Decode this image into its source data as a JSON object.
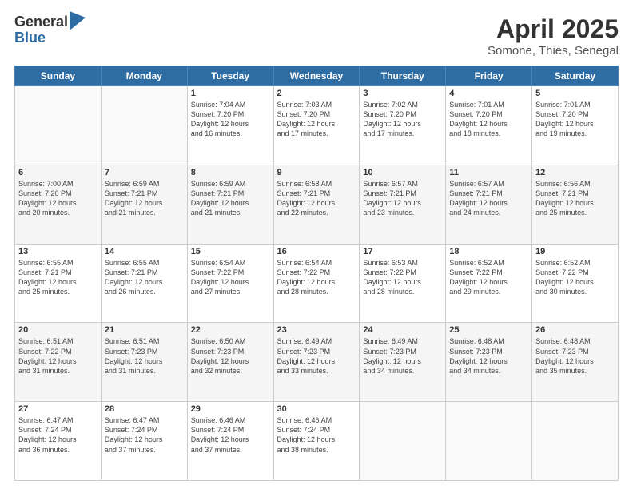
{
  "logo": {
    "general": "General",
    "blue": "Blue"
  },
  "header": {
    "month": "April 2025",
    "location": "Somone, Thies, Senegal"
  },
  "weekdays": [
    "Sunday",
    "Monday",
    "Tuesday",
    "Wednesday",
    "Thursday",
    "Friday",
    "Saturday"
  ],
  "weeks": [
    [
      {
        "day": "",
        "info": ""
      },
      {
        "day": "",
        "info": ""
      },
      {
        "day": "1",
        "info": "Sunrise: 7:04 AM\nSunset: 7:20 PM\nDaylight: 12 hours\nand 16 minutes."
      },
      {
        "day": "2",
        "info": "Sunrise: 7:03 AM\nSunset: 7:20 PM\nDaylight: 12 hours\nand 17 minutes."
      },
      {
        "day": "3",
        "info": "Sunrise: 7:02 AM\nSunset: 7:20 PM\nDaylight: 12 hours\nand 17 minutes."
      },
      {
        "day": "4",
        "info": "Sunrise: 7:01 AM\nSunset: 7:20 PM\nDaylight: 12 hours\nand 18 minutes."
      },
      {
        "day": "5",
        "info": "Sunrise: 7:01 AM\nSunset: 7:20 PM\nDaylight: 12 hours\nand 19 minutes."
      }
    ],
    [
      {
        "day": "6",
        "info": "Sunrise: 7:00 AM\nSunset: 7:20 PM\nDaylight: 12 hours\nand 20 minutes."
      },
      {
        "day": "7",
        "info": "Sunrise: 6:59 AM\nSunset: 7:21 PM\nDaylight: 12 hours\nand 21 minutes."
      },
      {
        "day": "8",
        "info": "Sunrise: 6:59 AM\nSunset: 7:21 PM\nDaylight: 12 hours\nand 21 minutes."
      },
      {
        "day": "9",
        "info": "Sunrise: 6:58 AM\nSunset: 7:21 PM\nDaylight: 12 hours\nand 22 minutes."
      },
      {
        "day": "10",
        "info": "Sunrise: 6:57 AM\nSunset: 7:21 PM\nDaylight: 12 hours\nand 23 minutes."
      },
      {
        "day": "11",
        "info": "Sunrise: 6:57 AM\nSunset: 7:21 PM\nDaylight: 12 hours\nand 24 minutes."
      },
      {
        "day": "12",
        "info": "Sunrise: 6:56 AM\nSunset: 7:21 PM\nDaylight: 12 hours\nand 25 minutes."
      }
    ],
    [
      {
        "day": "13",
        "info": "Sunrise: 6:55 AM\nSunset: 7:21 PM\nDaylight: 12 hours\nand 25 minutes."
      },
      {
        "day": "14",
        "info": "Sunrise: 6:55 AM\nSunset: 7:21 PM\nDaylight: 12 hours\nand 26 minutes."
      },
      {
        "day": "15",
        "info": "Sunrise: 6:54 AM\nSunset: 7:22 PM\nDaylight: 12 hours\nand 27 minutes."
      },
      {
        "day": "16",
        "info": "Sunrise: 6:54 AM\nSunset: 7:22 PM\nDaylight: 12 hours\nand 28 minutes."
      },
      {
        "day": "17",
        "info": "Sunrise: 6:53 AM\nSunset: 7:22 PM\nDaylight: 12 hours\nand 28 minutes."
      },
      {
        "day": "18",
        "info": "Sunrise: 6:52 AM\nSunset: 7:22 PM\nDaylight: 12 hours\nand 29 minutes."
      },
      {
        "day": "19",
        "info": "Sunrise: 6:52 AM\nSunset: 7:22 PM\nDaylight: 12 hours\nand 30 minutes."
      }
    ],
    [
      {
        "day": "20",
        "info": "Sunrise: 6:51 AM\nSunset: 7:22 PM\nDaylight: 12 hours\nand 31 minutes."
      },
      {
        "day": "21",
        "info": "Sunrise: 6:51 AM\nSunset: 7:23 PM\nDaylight: 12 hours\nand 31 minutes."
      },
      {
        "day": "22",
        "info": "Sunrise: 6:50 AM\nSunset: 7:23 PM\nDaylight: 12 hours\nand 32 minutes."
      },
      {
        "day": "23",
        "info": "Sunrise: 6:49 AM\nSunset: 7:23 PM\nDaylight: 12 hours\nand 33 minutes."
      },
      {
        "day": "24",
        "info": "Sunrise: 6:49 AM\nSunset: 7:23 PM\nDaylight: 12 hours\nand 34 minutes."
      },
      {
        "day": "25",
        "info": "Sunrise: 6:48 AM\nSunset: 7:23 PM\nDaylight: 12 hours\nand 34 minutes."
      },
      {
        "day": "26",
        "info": "Sunrise: 6:48 AM\nSunset: 7:23 PM\nDaylight: 12 hours\nand 35 minutes."
      }
    ],
    [
      {
        "day": "27",
        "info": "Sunrise: 6:47 AM\nSunset: 7:24 PM\nDaylight: 12 hours\nand 36 minutes."
      },
      {
        "day": "28",
        "info": "Sunrise: 6:47 AM\nSunset: 7:24 PM\nDaylight: 12 hours\nand 37 minutes."
      },
      {
        "day": "29",
        "info": "Sunrise: 6:46 AM\nSunset: 7:24 PM\nDaylight: 12 hours\nand 37 minutes."
      },
      {
        "day": "30",
        "info": "Sunrise: 6:46 AM\nSunset: 7:24 PM\nDaylight: 12 hours\nand 38 minutes."
      },
      {
        "day": "",
        "info": ""
      },
      {
        "day": "",
        "info": ""
      },
      {
        "day": "",
        "info": ""
      }
    ]
  ]
}
